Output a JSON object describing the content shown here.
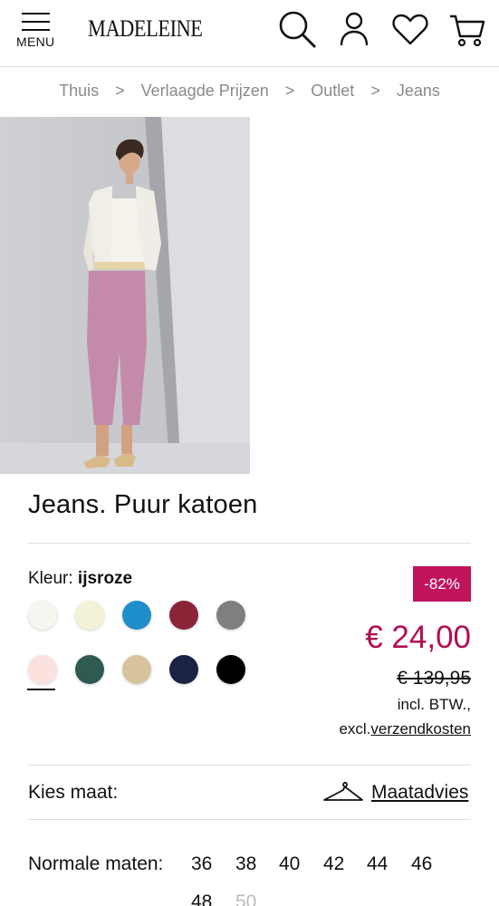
{
  "header": {
    "menu_label": "MENU",
    "logo": "MADELEINE"
  },
  "breadcrumb": [
    "Thuis",
    "Verlaagde Prijzen",
    "Outlet",
    "Jeans"
  ],
  "breadcrumb_separator": ">",
  "product": {
    "title": "Jeans. Puur katoen",
    "color_label": "Kleur:",
    "color_value": "ijsroze",
    "swatches": [
      "#f6f5ef",
      "#f3f2d7",
      "#1f8dc9",
      "#8c2438",
      "#7f7f7f",
      "#fbe2df",
      "#2f5a52",
      "#d7c39c",
      "#1b2246",
      "#000000"
    ],
    "selected_swatch": "#fbe2df",
    "discount": "-82%",
    "price": "€ 24,00",
    "old_price": "€ 139,95",
    "vat": "incl. BTW.,",
    "shipping_prefix": "excl.",
    "shipping_link": "verzendkosten"
  },
  "size": {
    "choose_label": "Kies maat:",
    "advice_label": "Maatadvies",
    "normal_label": "Normale maten:",
    "sizes": [
      "36",
      "38",
      "40",
      "42",
      "44",
      "46",
      "48",
      "50"
    ]
  },
  "colors": {
    "accent": "#b10f55",
    "badge": "#c0155d"
  },
  "icons": [
    "menu-icon",
    "search-icon",
    "account-icon",
    "heart-icon",
    "cart-icon",
    "hanger-icon"
  ]
}
